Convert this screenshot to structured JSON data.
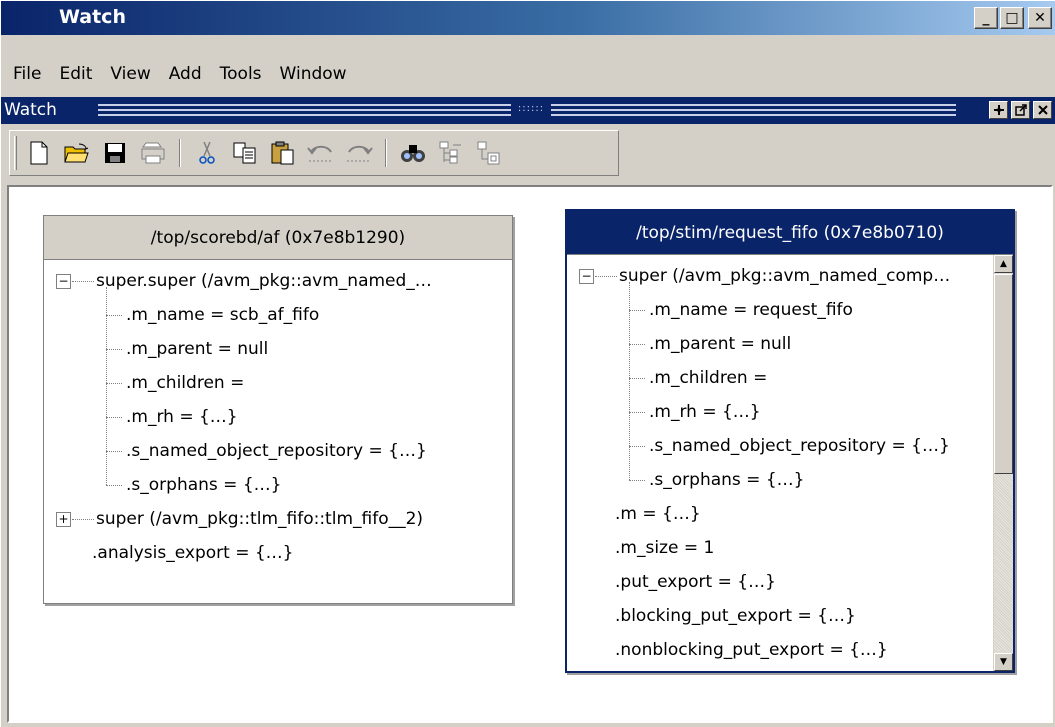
{
  "window": {
    "title": "Watch",
    "caption": {
      "minimize": "_",
      "maximize": "□",
      "close": "✕"
    }
  },
  "menubar": [
    "File",
    "Edit",
    "View",
    "Add",
    "Tools",
    "Window"
  ],
  "dock": {
    "title": "Watch",
    "buttons": [
      "undock-icon",
      "pin-icon",
      "close-icon"
    ]
  },
  "toolbar": {
    "buttons": [
      "new-file-icon",
      "open-folder-icon",
      "save-icon",
      "print-icon",
      "cut-icon",
      "copy-icon",
      "paste-icon",
      "undo-icon",
      "redo-icon",
      "find-icon",
      "expand-tree-icon",
      "collapse-tree-icon"
    ]
  },
  "panels": [
    {
      "header": "/top/scorebd/af (0x7e8b1290)",
      "selected": false,
      "rows": [
        {
          "text": "super.super (/avm_pkg::avm_named_…",
          "level": 0,
          "expander": "minus"
        },
        {
          "text": ".m_name = scb_af_fifo",
          "level": 1
        },
        {
          "text": ".m_parent = null",
          "level": 1
        },
        {
          "text": ".m_children =",
          "level": 1
        },
        {
          "text": ".m_rh = {…}",
          "level": 1
        },
        {
          "text": ".s_named_object_repository = {…}",
          "level": 1
        },
        {
          "text": ".s_orphans = {…}",
          "level": 1
        },
        {
          "text": "super (/avm_pkg::tlm_fifo::tlm_fifo__2)",
          "level": 0,
          "expander": "plus"
        },
        {
          "text": ".analysis_export = {…}",
          "level": 0
        }
      ]
    },
    {
      "header": "/top/stim/request_fifo (0x7e8b0710)",
      "selected": true,
      "rows": [
        {
          "text": "super (/avm_pkg::avm_named_comp…",
          "level": 0,
          "expander": "minus"
        },
        {
          "text": ".m_name = request_fifo",
          "level": 1
        },
        {
          "text": ".m_parent = null",
          "level": 1
        },
        {
          "text": ".m_children =",
          "level": 1
        },
        {
          "text": ".m_rh = {…}",
          "level": 1
        },
        {
          "text": ".s_named_object_repository = {…}",
          "level": 1
        },
        {
          "text": ".s_orphans = {…}",
          "level": 1
        },
        {
          "text": ".m = {…}",
          "level": 0
        },
        {
          "text": ".m_size = 1",
          "level": 0
        },
        {
          "text": ".put_export = {…}",
          "level": 0
        },
        {
          "text": ".blocking_put_export = {…}",
          "level": 0
        },
        {
          "text": ".nonblocking_put_export = {…}",
          "level": 0
        }
      ]
    }
  ],
  "colors": {
    "titlebar": "#0a246a",
    "face": "#d4d0c8",
    "selected_header": "#0a246a"
  }
}
